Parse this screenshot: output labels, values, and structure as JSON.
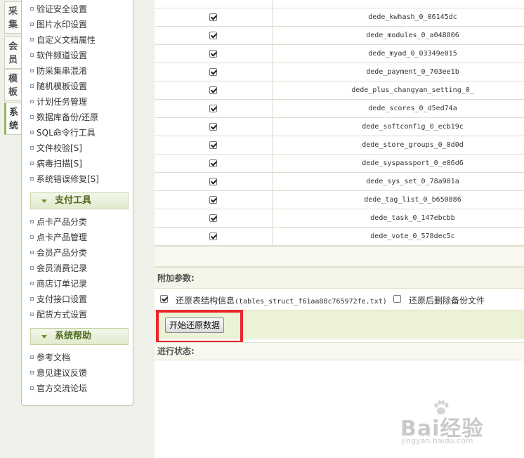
{
  "tabs": [
    {
      "label": "采集",
      "chars": [
        "采",
        "集"
      ],
      "active": false
    },
    {
      "label": "会员",
      "chars": [
        "会",
        "员"
      ],
      "active": false
    },
    {
      "label": "模板",
      "chars": [
        "模",
        "板"
      ],
      "active": false
    },
    {
      "label": "系统",
      "chars": [
        "系",
        "统"
      ],
      "active": true
    }
  ],
  "menu": {
    "system_items": [
      "验证安全设置",
      "图片水印设置",
      "自定义文档属性",
      "软件频道设置",
      "防采集串混淆",
      "随机模板设置",
      "计划任务管理",
      "数据库备份/还原",
      "SQL命令行工具",
      "文件校验[S]",
      "病毒扫描[S]",
      "系统错误修复[S]"
    ],
    "payment_section": "支付工具",
    "payment_items": [
      "点卡产品分类",
      "点卡产品管理",
      "会员产品分类",
      "会员消费记录",
      "商店订单记录",
      "支付接口设置",
      "配货方式设置"
    ],
    "help_section": "系统帮助",
    "help_items": [
      "参考文档",
      "意见建议反馈",
      "官方交流论坛"
    ]
  },
  "tables": [
    {
      "name": "dede_kwhash_0_06145dc",
      "checked": true
    },
    {
      "name": "dede_modules_0_a048806",
      "checked": true
    },
    {
      "name": "dede_myad_0_03349e015",
      "checked": true
    },
    {
      "name": "dede_payment_0_703ee1b",
      "checked": true
    },
    {
      "name": "dede_plus_changyan_setting_0_",
      "checked": true
    },
    {
      "name": "dede_scores_0_d5ed74a",
      "checked": true
    },
    {
      "name": "dede_softconfig_0_ecb19c",
      "checked": true
    },
    {
      "name": "dede_store_groups_0_0d0d",
      "checked": true
    },
    {
      "name": "dede_syspassport_0_e06d6",
      "checked": true
    },
    {
      "name": "dede_sys_set_0_78a901a",
      "checked": true
    },
    {
      "name": "dede_tag_list_0_b650886",
      "checked": true
    },
    {
      "name": "dede_task_0_147ebcbb",
      "checked": true
    },
    {
      "name": "dede_vote_0_578dec5c",
      "checked": true
    }
  ],
  "extra_params": {
    "label": "附加参数:",
    "restore_struct": {
      "checked": true,
      "text": "还原表结构信息",
      "file": "(tables_struct_f61aa88c765972fe.txt)"
    },
    "delete_backup": {
      "checked": false,
      "text": "还原后删除备份文件"
    }
  },
  "start_button": "开始还原数据",
  "status_label": "进行状态:",
  "watermark": {
    "brand": "Bai经验",
    "url": "jingyan.baidu.com"
  }
}
